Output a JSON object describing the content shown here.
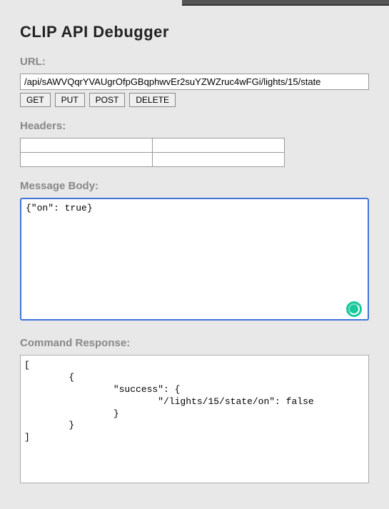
{
  "title": "CLIP API Debugger",
  "labels": {
    "url": "URL:",
    "headers": "Headers:",
    "body": "Message Body:",
    "response": "Command Response:"
  },
  "url_value": "/api/sAWVQqrYVAUgrOfpGBqphwvEr2suYZWZruc4wFGi/lights/15/state",
  "methods": {
    "get": "GET",
    "put": "PUT",
    "post": "POST",
    "delete": "DELETE"
  },
  "headers_rows": [
    {
      "key": "",
      "value": ""
    },
    {
      "key": "",
      "value": ""
    }
  ],
  "body_text": "{\"on\": true}",
  "response_text": "[\n        {\n                \"success\": {\n                        \"/lights/15/state/on\": false\n                }\n        }\n]"
}
